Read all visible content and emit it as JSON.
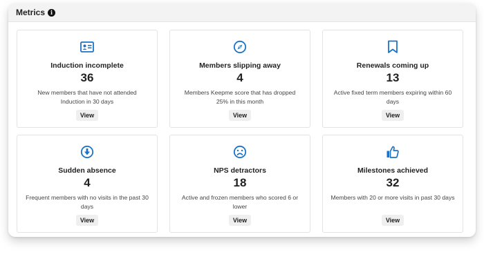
{
  "header": {
    "title": "Metrics",
    "info_icon": "info-icon"
  },
  "accent_color": "#1a73c8",
  "cards": [
    {
      "title": "Induction incomplete",
      "value": "36",
      "description": "New members that have not attended Induction in 30 days",
      "button": "View",
      "icon": "id-card-icon"
    },
    {
      "title": "Members slipping away",
      "value": "4",
      "description": "Members Keepme score that has dropped 25% in this month",
      "button": "View",
      "icon": "compass-icon"
    },
    {
      "title": "Renewals coming up",
      "value": "13",
      "description": "Active fixed term members expiring within 60 days",
      "button": "View",
      "icon": "bookmark-icon"
    },
    {
      "title": "Sudden absence",
      "value": "4",
      "description": "Frequent members with no visits in the past 30 days",
      "button": "View",
      "icon": "arrow-down-circle-icon"
    },
    {
      "title": "NPS detractors",
      "value": "18",
      "description": "Active and frozen members who scored 6 or lower",
      "button": "View",
      "icon": "frown-icon"
    },
    {
      "title": "Milestones achieved",
      "value": "32",
      "description": "Members with 20 or more visits in past 30 days",
      "button": "View",
      "icon": "thumbs-up-icon"
    }
  ]
}
